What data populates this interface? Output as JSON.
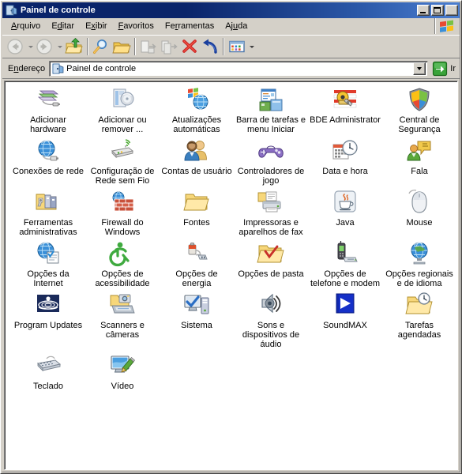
{
  "window": {
    "title": "Painel de controle",
    "title_icon": "control-panel-icon",
    "buttons": {
      "minimize": "Minimizar",
      "maximize": "Maximizar",
      "close": "Fechar"
    }
  },
  "menubar": {
    "items": [
      {
        "label": "Arquivo",
        "mnemonic_index": 0
      },
      {
        "label": "Editar",
        "mnemonic_index": 1
      },
      {
        "label": "Exibir",
        "mnemonic_index": 1
      },
      {
        "label": "Favoritos",
        "mnemonic_index": 0
      },
      {
        "label": "Ferramentas",
        "mnemonic_index": 2
      },
      {
        "label": "Ajuda",
        "mnemonic_index": 2
      }
    ],
    "logo": "windows-flag-logo"
  },
  "toolbar": {
    "buttons": [
      {
        "name": "back-button",
        "label": "Voltar",
        "icon": "back-arrow-icon",
        "disabled": true,
        "has_dropdown": true
      },
      {
        "name": "forward-button",
        "label": "Avançar",
        "icon": "forward-arrow-icon",
        "disabled": true,
        "has_dropdown": true
      },
      {
        "name": "up-button",
        "label": "Acima",
        "icon": "up-folder-icon",
        "disabled": false
      },
      {
        "name": "search-button",
        "label": "Pesquisar",
        "icon": "search-icon",
        "disabled": false
      },
      {
        "name": "folders-button",
        "label": "Pastas",
        "icon": "folders-icon",
        "disabled": false
      },
      {
        "name": "move-to-button",
        "label": "Mover para",
        "icon": "move-to-icon",
        "disabled": true
      },
      {
        "name": "copy-to-button",
        "label": "Copiar para",
        "icon": "copy-to-icon",
        "disabled": true
      },
      {
        "name": "delete-button",
        "label": "Excluir",
        "icon": "delete-x-icon",
        "disabled": false
      },
      {
        "name": "undo-button",
        "label": "Desfazer",
        "icon": "undo-arrow-icon",
        "disabled": false
      },
      {
        "name": "views-button",
        "label": "Modos de exibição",
        "icon": "views-icon",
        "disabled": false,
        "has_dropdown": true
      }
    ]
  },
  "addressbar": {
    "label": "Endereço",
    "label_mnemonic_index": 1,
    "icon": "control-panel-icon",
    "value": "Painel de controle",
    "placeholder": "Painel de controle",
    "dropdown_icon": "chevron-down-icon",
    "go_label": "Ir",
    "go_icon": "go-arrow-icon"
  },
  "content": {
    "items": [
      {
        "label": "Adicionar hardware",
        "icon": "add-hardware-icon"
      },
      {
        "label": "Adicionar ou remover ...",
        "icon": "add-remove-programs-icon"
      },
      {
        "label": "Atualizações automáticas",
        "icon": "automatic-updates-icon"
      },
      {
        "label": "Barra de tarefas e menu Iniciar",
        "icon": "taskbar-start-menu-icon"
      },
      {
        "label": "BDE Administrator",
        "icon": "bde-administrator-icon"
      },
      {
        "label": "Central de Segurança",
        "icon": "security-center-shield-icon"
      },
      {
        "label": "Conexões de rede",
        "icon": "network-connections-icon"
      },
      {
        "label": "Configuração de Rede sem Fio",
        "icon": "wireless-network-setup-icon"
      },
      {
        "label": "Contas de usuário",
        "icon": "user-accounts-icon"
      },
      {
        "label": "Controladores de jogo",
        "icon": "game-controllers-icon"
      },
      {
        "label": "Data e hora",
        "icon": "date-time-icon"
      },
      {
        "label": "Fala",
        "icon": "speech-icon"
      },
      {
        "label": "Ferramentas administrativas",
        "icon": "administrative-tools-icon"
      },
      {
        "label": "Firewall do Windows",
        "icon": "windows-firewall-icon"
      },
      {
        "label": "Fontes",
        "icon": "fonts-folder-icon"
      },
      {
        "label": "Impressoras e aparelhos de fax",
        "icon": "printers-faxes-icon"
      },
      {
        "label": "Java",
        "icon": "java-icon"
      },
      {
        "label": "Mouse",
        "icon": "mouse-icon"
      },
      {
        "label": "Opções da Internet",
        "icon": "internet-options-icon"
      },
      {
        "label": "Opções de acessibilidade",
        "icon": "accessibility-options-icon"
      },
      {
        "label": "Opções de energia",
        "icon": "power-options-icon"
      },
      {
        "label": "Opções de pasta",
        "icon": "folder-options-icon"
      },
      {
        "label": "Opções de telefone e modem",
        "icon": "phone-modem-options-icon"
      },
      {
        "label": "Opções regionais e de idioma",
        "icon": "regional-language-options-icon"
      },
      {
        "label": "Program Updates",
        "icon": "program-updates-icon"
      },
      {
        "label": "Scanners e câmeras",
        "icon": "scanners-cameras-icon"
      },
      {
        "label": "Sistema",
        "icon": "system-icon"
      },
      {
        "label": "Sons e dispositivos de áudio",
        "icon": "sounds-audio-devices-icon"
      },
      {
        "label": "SoundMAX",
        "icon": "soundmax-icon"
      },
      {
        "label": "Tarefas agendadas",
        "icon": "scheduled-tasks-icon"
      },
      {
        "label": "Teclado",
        "icon": "keyboard-icon"
      },
      {
        "label": "Vídeo",
        "icon": "display-video-icon"
      }
    ]
  },
  "colors": {
    "title_bar_start": "#0a246a",
    "title_bar_end": "#4b7ed0",
    "face": "#d4d0c8",
    "content_bg": "#ffffff",
    "go_green": "#2f9a2f",
    "delete_red": "#cc2222",
    "undo_blue": "#1a3f9c"
  }
}
